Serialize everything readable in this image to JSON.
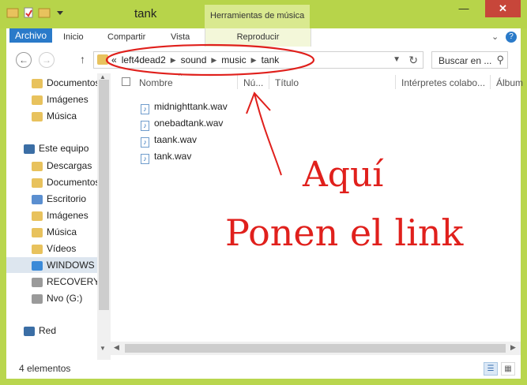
{
  "window": {
    "title": "tank",
    "context_tab_header": "Herramientas de música",
    "buttons": {
      "minimize": "—",
      "maximize": "☐",
      "close": "✕"
    }
  },
  "ribbon": {
    "tabs": [
      "Archivo",
      "Inicio",
      "Compartir",
      "Vista",
      "Reproducir"
    ],
    "help": "?",
    "collapse": "⌄"
  },
  "address": {
    "back": "←",
    "forward": "→",
    "up": "↑",
    "overflow": "«",
    "crumbs": [
      "left4dead2",
      "sound",
      "music",
      "tank"
    ],
    "search_placeholder": "Buscar en ..."
  },
  "navpane": {
    "items": [
      {
        "label": "Documentos",
        "icon": "folder-icon"
      },
      {
        "label": "Imágenes",
        "icon": "folder-icon"
      },
      {
        "label": "Música",
        "icon": "folder-icon"
      },
      {
        "label": "Este equipo",
        "icon": "computer-icon"
      },
      {
        "label": "Descargas",
        "icon": "download-folder-icon"
      },
      {
        "label": "Documentos",
        "icon": "folder-icon"
      },
      {
        "label": "Escritorio",
        "icon": "desktop-folder-icon"
      },
      {
        "label": "Imágenes",
        "icon": "folder-icon"
      },
      {
        "label": "Música",
        "icon": "folder-icon"
      },
      {
        "label": "Vídeos",
        "icon": "folder-icon"
      },
      {
        "label": "WINDOWS",
        "icon": "windows-drive-icon"
      },
      {
        "label": "RECOVERY",
        "icon": "drive-icon"
      },
      {
        "label": "Nvo (G:)",
        "icon": "drive-icon"
      },
      {
        "label": "Red",
        "icon": "network-icon"
      }
    ],
    "selected": "WINDOWS"
  },
  "columns": [
    "Nombre",
    "Nú...",
    "Título",
    "Intérpretes colabo...",
    "Álbum"
  ],
  "files": [
    {
      "name": "midnighttank.wav",
      "icon": "audio-file-icon"
    },
    {
      "name": "onebadtank.wav",
      "icon": "audio-file-icon"
    },
    {
      "name": "taank.wav",
      "icon": "audio-file-icon"
    },
    {
      "name": "tank.wav",
      "icon": "audio-file-icon"
    }
  ],
  "annotation": {
    "line1": "Aquí",
    "line2": "Ponen el link",
    "color": "#e0201c"
  },
  "status": {
    "count": "4 elementos"
  },
  "colors": {
    "frame": "#b9d64e",
    "accent": "#2a7ac9",
    "close": "#c7463a"
  }
}
